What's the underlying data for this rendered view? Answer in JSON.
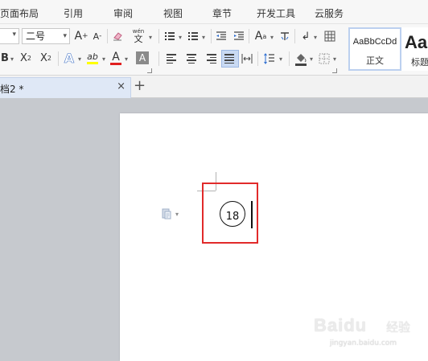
{
  "menu": {
    "tabs": [
      {
        "label": "页面布局"
      },
      {
        "label": "引用"
      },
      {
        "label": "审阅"
      },
      {
        "label": "视图"
      },
      {
        "label": "章节"
      },
      {
        "label": "开发工具"
      },
      {
        "label": "云服务"
      }
    ]
  },
  "ribbon": {
    "font_size_value": "二号",
    "font_size_dropdown": "▾",
    "grow_font_glyph": "A",
    "grow_font_sup": "+",
    "shrink_font_glyph": "A",
    "shrink_font_sup": "-",
    "phonetic_top": "wén",
    "phonetic_bottom": "文",
    "bold_glyph": "B",
    "superscript_glyph": "X",
    "superscript_sup": "2",
    "subscript_glyph": "X",
    "subscript_sub": "2",
    "text_effect_glyph": "A",
    "highlight_glyph": "ab",
    "font_color_glyph": "A",
    "char_shading_glyph": "A",
    "change_case_glyph": "A",
    "change_case_sup": "a",
    "show_hide_glyph": "↲",
    "styles": [
      {
        "sample": "AaBbCcDd",
        "label": "正文"
      },
      {
        "sample": "Aa",
        "label": "标题"
      }
    ],
    "colors": {
      "font_color_bar": "#e02020",
      "highlight_bar": "#ffff00",
      "text_effect": "#4a78c8"
    }
  },
  "document_tabs": {
    "active_label": "档2 *",
    "close_glyph": "×",
    "new_tab_glyph": "+"
  },
  "document": {
    "enclosed_character": "18",
    "highlight_color": "#e12a2a"
  },
  "watermark": {
    "logo": "Baidu",
    "text": "经验",
    "url": "jingyan.baidu.com"
  }
}
